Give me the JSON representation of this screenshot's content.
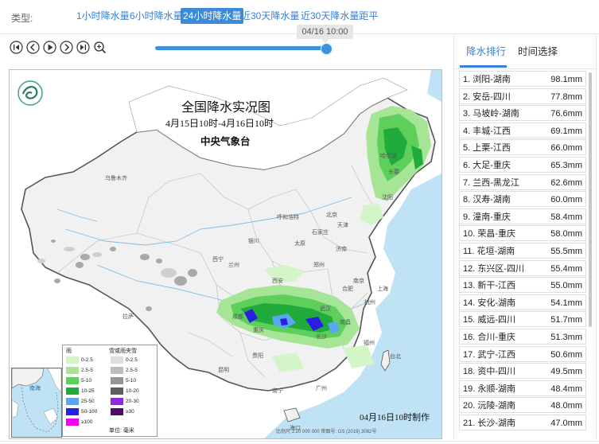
{
  "typebar": {
    "label": "类型:",
    "tabs": [
      {
        "label": "1小时降水量",
        "active": false
      },
      {
        "label": "6小时降水量",
        "active": false
      },
      {
        "label": "24小时降水量",
        "active": true
      },
      {
        "label": "近30天降水量",
        "active": false
      },
      {
        "label": "近30天降水量距平",
        "active": false
      }
    ]
  },
  "player": {
    "current_time": "04/16 10:00",
    "progress": 1.0
  },
  "map": {
    "title": "全国降水实况图",
    "subtitle": "4月15日10时-4月16日10时",
    "organization": "中央气象台",
    "made_time": "04月16日10时制作",
    "scale_text": "比例尺 1:20 000 000   审图号: GS (2019) 3082号",
    "cities": {
      "wulumuqi": "乌鲁木齐",
      "lasa": "拉萨",
      "xining": "西宁",
      "lanzhou": "兰州",
      "yinchuan": "银川",
      "huhehaote": "呼和浩特",
      "beijing": "北京",
      "tianjin": "天津",
      "shijiazhuang": "石家庄",
      "taiyuan": "太原",
      "jinan": "济南",
      "zhengzhou": "郑州",
      "xian": "西安",
      "chengdu": "成都",
      "chongqing": "重庆",
      "guiyang": "贵阳",
      "kunming": "昆明",
      "nanning": "南宁",
      "guangzhou": "广州",
      "haikou": "海口",
      "changsha": "长沙",
      "wuhan": "武汉",
      "hefei": "合肥",
      "nanjing": "南京",
      "shanghai": "上海",
      "hangzhou": "杭州",
      "fuzhou": "福州",
      "nanchang": "南昌",
      "shenyang": "沈阳",
      "changchun": "长春",
      "haerbin": "哈尔滨",
      "taibei": "台北",
      "nanhai": "南海"
    },
    "legend": {
      "rain_header": "雨",
      "mixed_header": "雪或雨夹雪",
      "unit": "单位: 毫米",
      "rain": [
        {
          "label": "0-2.5",
          "color": "#d4f5c8"
        },
        {
          "label": "2.5-5",
          "color": "#a6e596"
        },
        {
          "label": "5-10",
          "color": "#5fcf5c"
        },
        {
          "label": "10-25",
          "color": "#21ab3c"
        },
        {
          "label": "25-50",
          "color": "#5ba7ee"
        },
        {
          "label": "50-100",
          "color": "#2a1ee3"
        },
        {
          "label": "≥100",
          "color": "#f200f2"
        }
      ],
      "mixed": [
        {
          "label": "0-2.5",
          "color": "#dedede"
        },
        {
          "label": "2.5-5",
          "color": "#bdbdbd"
        },
        {
          "label": "5-10",
          "color": "#959595"
        },
        {
          "label": "10-20",
          "color": "#5e5e5e"
        },
        {
          "label": "20-30",
          "color": "#8c2cd6"
        },
        {
          "label": "≥30",
          "color": "#4b0f6b"
        }
      ]
    }
  },
  "ranking": {
    "tabs": [
      {
        "label": "降水排行",
        "active": true
      },
      {
        "label": "时间选择",
        "active": false
      }
    ],
    "items": [
      {
        "name": "1. 浏阳-湖南",
        "value": "98.1mm"
      },
      {
        "name": "2. 安岳-四川",
        "value": "77.8mm"
      },
      {
        "name": "3. 马坡岭-湖南",
        "value": "76.6mm"
      },
      {
        "name": "4. 丰城-江西",
        "value": "69.1mm"
      },
      {
        "name": "5. 上栗-江西",
        "value": "66.0mm"
      },
      {
        "name": "6. 大足-重庆",
        "value": "65.3mm"
      },
      {
        "name": "7. 兰西-黑龙江",
        "value": "62.6mm"
      },
      {
        "name": "8. 汉寿-湖南",
        "value": "60.0mm"
      },
      {
        "name": "9. 潼南-重庆",
        "value": "58.4mm"
      },
      {
        "name": "10. 荣昌-重庆",
        "value": "58.0mm"
      },
      {
        "name": "11. 花垣-湖南",
        "value": "55.5mm"
      },
      {
        "name": "12. 东兴区-四川",
        "value": "55.4mm"
      },
      {
        "name": "13. 新干-江西",
        "value": "55.0mm"
      },
      {
        "name": "14. 安化-湖南",
        "value": "54.1mm"
      },
      {
        "name": "15. 威远-四川",
        "value": "51.7mm"
      },
      {
        "name": "16. 合川-重庆",
        "value": "51.3mm"
      },
      {
        "name": "17. 武宁-江西",
        "value": "50.6mm"
      },
      {
        "name": "18. 资中-四川",
        "value": "49.5mm"
      },
      {
        "name": "19. 永顺-湖南",
        "value": "48.4mm"
      },
      {
        "name": "20. 沅陵-湖南",
        "value": "48.0mm"
      },
      {
        "name": "21. 长沙-湖南",
        "value": "47.0mm"
      }
    ]
  }
}
